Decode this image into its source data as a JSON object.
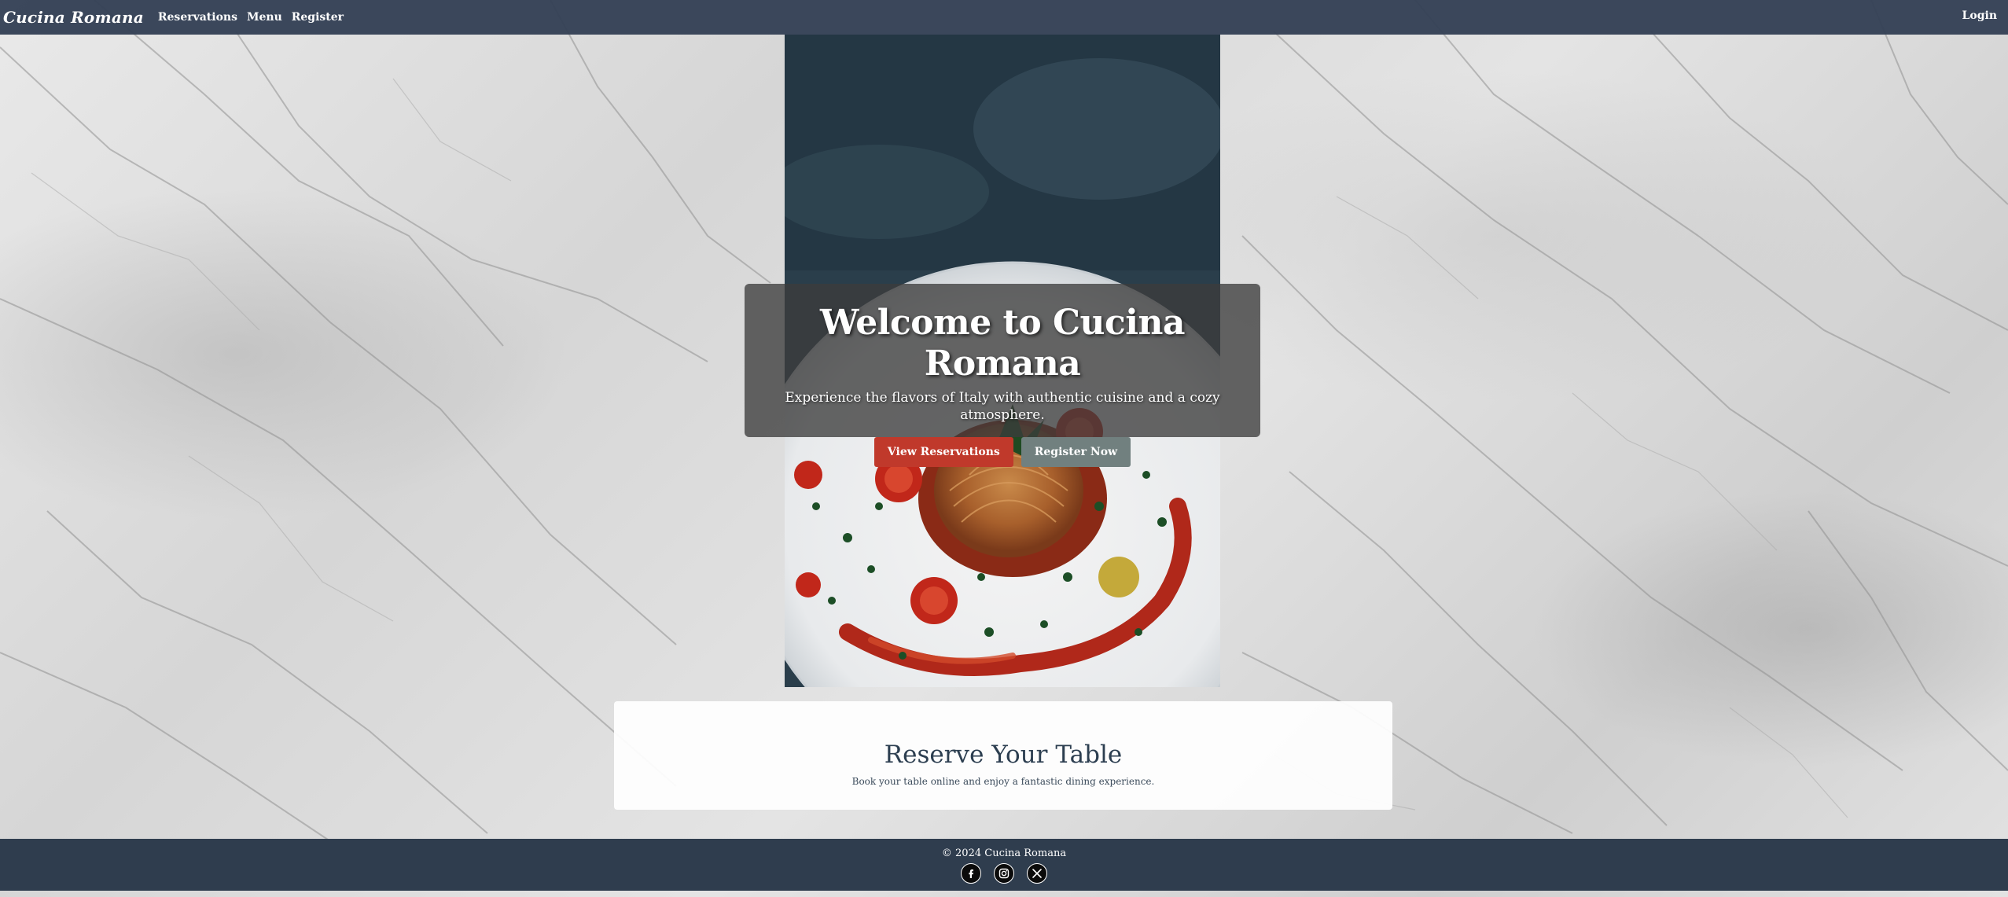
{
  "nav": {
    "brand": "Cucina Romana",
    "links": [
      {
        "label": "Reservations"
      },
      {
        "label": "Menu"
      },
      {
        "label": "Register"
      }
    ],
    "login_label": "Login"
  },
  "hero": {
    "title": "Welcome to Cucina Romana",
    "subtitle": "Experience the flavors of Italy with authentic cuisine and a cozy atmosphere.",
    "primary_button": "View Reservations",
    "secondary_button": "Register Now"
  },
  "reserve": {
    "title": "Reserve Your Table",
    "text": "Book your table online and enjoy a fantastic dining experience."
  },
  "footer": {
    "copyright": "© 2024 Cucina Romana",
    "social_icons": [
      "facebook-icon",
      "instagram-icon",
      "x-icon"
    ]
  },
  "colors": {
    "navbar": "#344155",
    "footer": "#2f3d4e",
    "primary_button": "#c0392b",
    "secondary_button": "#71807f",
    "heading_text": "#2c3e50"
  }
}
